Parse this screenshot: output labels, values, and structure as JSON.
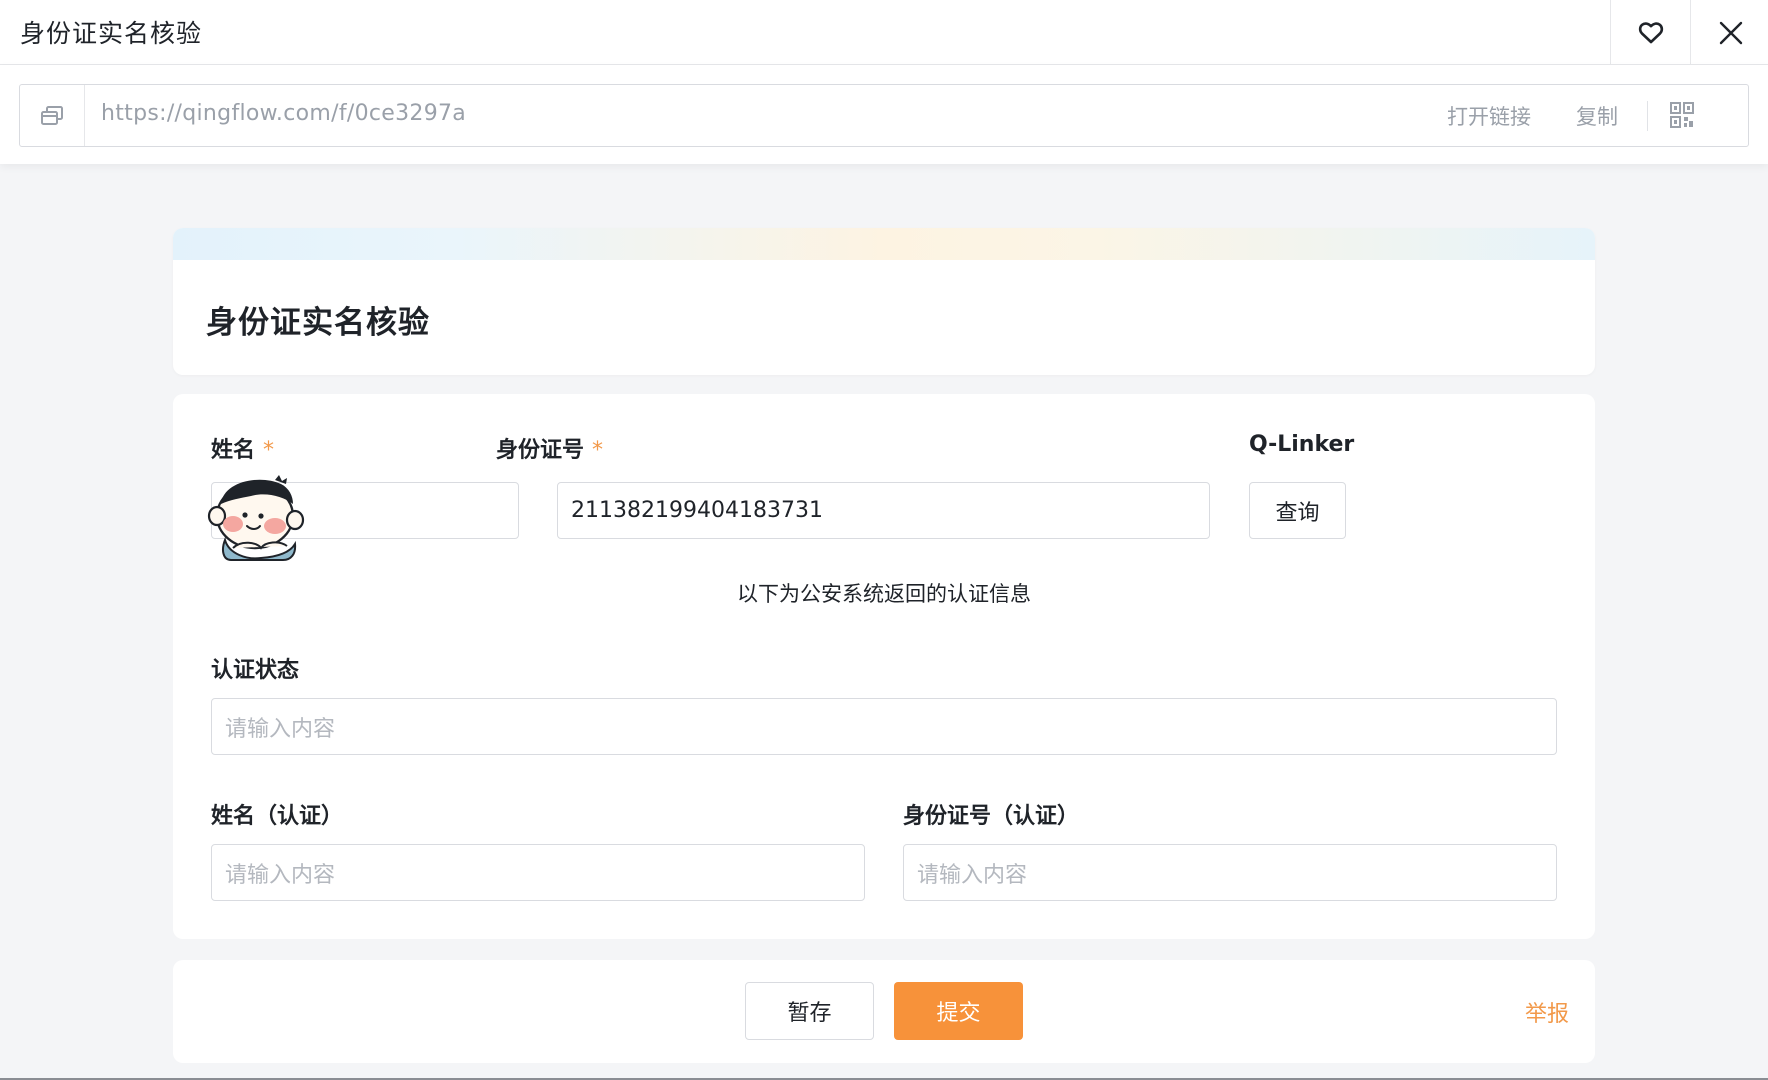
{
  "window": {
    "title": "身份证实名核验",
    "favorite_icon": "heart-icon",
    "close_icon": "close-icon"
  },
  "url_bar": {
    "link_icon": "copy-window-icon",
    "url": "https://qingflow.com/f/0ce3297a",
    "open_link_label": "打开链接",
    "copy_label": "复制",
    "qr_icon": "qr-code-icon"
  },
  "form": {
    "title": "身份证实名核验",
    "fields": {
      "name": {
        "label": "姓名",
        "required_mark": "*",
        "value": ""
      },
      "id_number": {
        "label": "身份证号",
        "required_mark": "*",
        "value": "211382199404183731"
      },
      "qlinker": {
        "label": "Q-Linker",
        "button_label": "查询"
      },
      "info_text": "以下为公安系统返回的认证信息",
      "auth_status": {
        "label": "认证状态",
        "placeholder": "请输入内容"
      },
      "auth_name": {
        "label": "姓名（认证）",
        "placeholder": "请输入内容"
      },
      "auth_id": {
        "label": "身份证号（认证）",
        "placeholder": "请输入内容"
      }
    }
  },
  "footer": {
    "save_label": "暂存",
    "submit_label": "提交",
    "report_label": "举报"
  },
  "colors": {
    "accent": "#f7923a",
    "required": "#f2994a",
    "border": "#d9dbe0",
    "background": "#f4f5f7"
  }
}
